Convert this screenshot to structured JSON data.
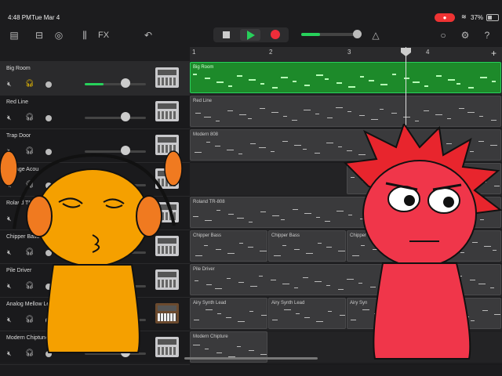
{
  "status": {
    "time": "4:48 PM",
    "date": "Tue Mar 4",
    "battery": "37%"
  },
  "toolbar": {
    "fx_label": "FX"
  },
  "ruler": {
    "marks": [
      "1",
      "2",
      "3",
      "4"
    ]
  },
  "tracks": [
    {
      "name": "Big Room",
      "solo": true,
      "instrument": "drum-machine"
    },
    {
      "name": "Red Line",
      "solo": false,
      "instrument": "drum-machine"
    },
    {
      "name": "Trap Door",
      "solo": false,
      "instrument": "drum-machine"
    },
    {
      "name": "Vintage Acou",
      "solo": false,
      "instrument": "drum-machine"
    },
    {
      "name": "Roland TR-808",
      "solo": false,
      "instrument": "drum-machine"
    },
    {
      "name": "Chipper Bass",
      "solo": false,
      "instrument": "synth"
    },
    {
      "name": "Pile Driver",
      "solo": false,
      "instrument": "drum-machine"
    },
    {
      "name": "Analog Mellow Lead",
      "solo": false,
      "instrument": "keyboard"
    },
    {
      "name": "Modern Chiptune",
      "solo": false,
      "instrument": "drum-machine"
    }
  ],
  "regions": [
    [
      {
        "label": "Big Room",
        "start": 0,
        "len": 398,
        "green": true
      }
    ],
    [
      {
        "label": "Red Line",
        "start": 0,
        "len": 398
      }
    ],
    [
      {
        "label": "Modern 808",
        "start": 0,
        "len": 398
      }
    ],
    [
      {
        "label": "Vintage",
        "start": 200,
        "len": 198
      }
    ],
    [
      {
        "label": "Roland TR-808",
        "start": 0,
        "len": 398
      }
    ],
    [
      {
        "label": "Chipper Bass",
        "start": 0,
        "len": 100
      },
      {
        "label": "Chipper Bass",
        "start": 100,
        "len": 100
      },
      {
        "label": "Chipper L",
        "start": 200,
        "len": 198
      }
    ],
    [
      {
        "label": "Pile Driver",
        "start": 0,
        "len": 398
      }
    ],
    [
      {
        "label": "Airy Synth Lead",
        "start": 0,
        "len": 100
      },
      {
        "label": "Airy Synth Lead",
        "start": 100,
        "len": 100
      },
      {
        "label": "Airy Syn",
        "start": 200,
        "len": 198
      }
    ],
    [
      {
        "label": "Modern Chipture",
        "start": 0,
        "len": 100
      }
    ]
  ]
}
